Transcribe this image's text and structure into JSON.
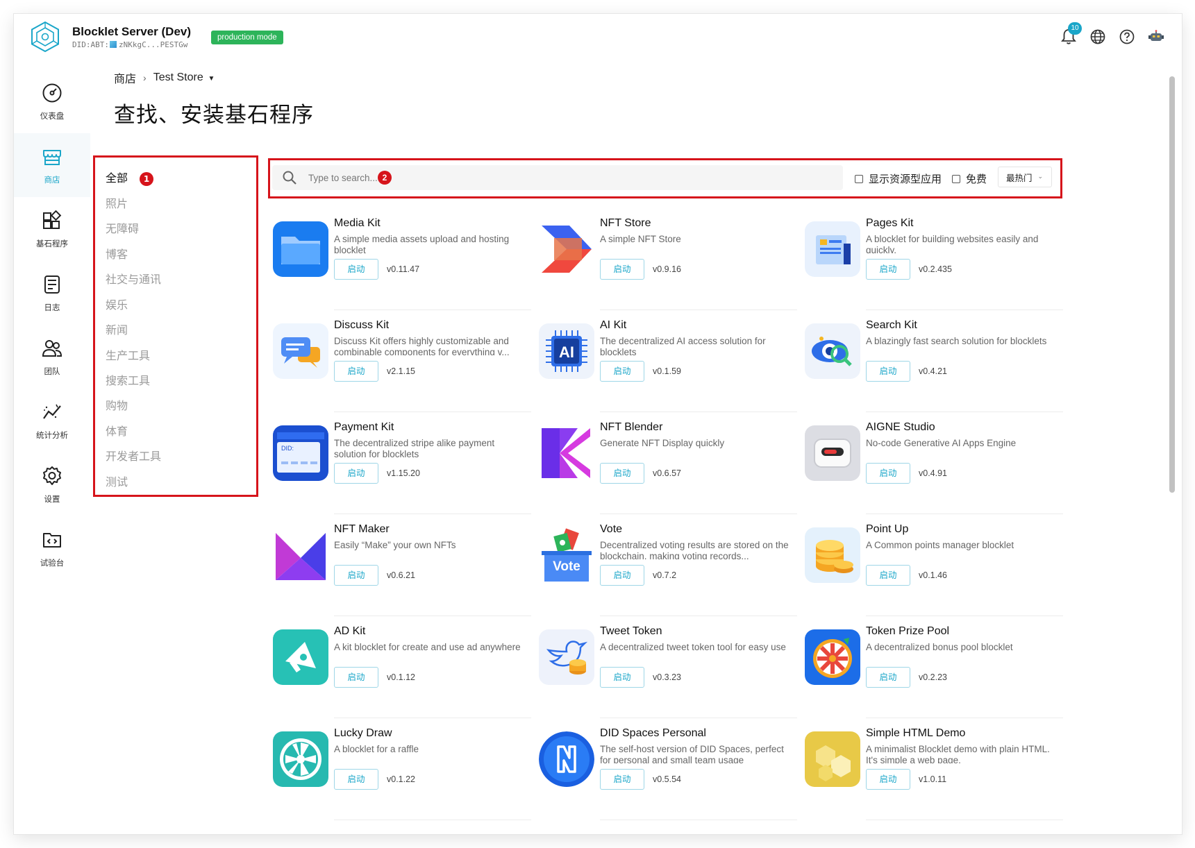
{
  "header": {
    "app_title": "Blocklet Server (Dev)",
    "did_prefix": "DID:ABT:",
    "did_value": "zNKkgC...PESTGw",
    "mode_badge": "production mode",
    "notification_count": "10"
  },
  "colors": {
    "accent": "#1aa6c9",
    "badge_green": "#2db45a",
    "highlight_red": "#d6141b"
  },
  "sidenav": [
    {
      "label": "仪表盘",
      "icon": "dashboard-icon"
    },
    {
      "label": "商店",
      "icon": "store-icon",
      "active": true
    },
    {
      "label": "基石程序",
      "icon": "blocklets-icon"
    },
    {
      "label": "日志",
      "icon": "logs-icon"
    },
    {
      "label": "团队",
      "icon": "team-icon"
    },
    {
      "label": "统计分析",
      "icon": "analytics-icon"
    },
    {
      "label": "设置",
      "icon": "settings-icon"
    },
    {
      "label": "试验台",
      "icon": "playground-icon"
    }
  ],
  "breadcrumb": {
    "root": "商店",
    "separator": "›",
    "current": "Test Store"
  },
  "page_title": "查找、安装基石程序",
  "categories": {
    "marker": "1",
    "items": [
      "全部",
      "照片",
      "无障碍",
      "博客",
      "社交与通讯",
      "娱乐",
      "新闻",
      "生产工具",
      "搜索工具",
      "购物",
      "体育",
      "开发者工具",
      "测试"
    ]
  },
  "search": {
    "placeholder": "Type to search...",
    "marker": "2",
    "show_resource_label": "显示资源型应用",
    "free_label": "免费",
    "sort_value": "最热门"
  },
  "apps": [
    {
      "name": "Media Kit",
      "desc": "A simple media assets upload and hosting blocklet",
      "version": "v0.11.47",
      "button": "启动",
      "icon": "folder-icon"
    },
    {
      "name": "NFT Store",
      "desc": "A simple NFT Store",
      "version": "v0.9.16",
      "button": "启动",
      "icon": "nft-store-icon"
    },
    {
      "name": "Pages Kit",
      "desc": "A blocklet for building websites easily and quickly.",
      "version": "v0.2.435",
      "button": "启动",
      "icon": "pages-icon"
    },
    {
      "name": "Discuss Kit",
      "desc": "Discuss Kit offers highly customizable and combinable components for everything v...",
      "version": "v2.1.15",
      "button": "启动",
      "icon": "chat-icon"
    },
    {
      "name": "AI Kit",
      "desc": "The decentralized AI access solution for blocklets",
      "version": "v0.1.59",
      "button": "启动",
      "icon": "ai-chip-icon"
    },
    {
      "name": "Search Kit",
      "desc": "A blazingly fast search solution for blocklets",
      "version": "v0.4.21",
      "button": "启动",
      "icon": "search-eye-icon"
    },
    {
      "name": "Payment Kit",
      "desc": "The decentralized stripe alike payment solution for blocklets",
      "version": "v1.15.20",
      "button": "启动",
      "icon": "payment-card-icon"
    },
    {
      "name": "NFT Blender",
      "desc": "Generate NFT Display quickly",
      "version": "v0.6.57",
      "button": "启动",
      "icon": "blender-icon"
    },
    {
      "name": "AIGNE Studio",
      "desc": "No-code Generative AI Apps Engine",
      "version": "v0.4.91",
      "button": "启动",
      "icon": "robot-icon"
    },
    {
      "name": "NFT Maker",
      "desc": "Easily “Make” your own NFTs",
      "version": "v0.6.21",
      "button": "启动",
      "icon": "nft-maker-icon"
    },
    {
      "name": "Vote",
      "desc": "Decentralized voting results are stored on the blockchain, making voting records...",
      "version": "v0.7.2",
      "button": "启动",
      "icon": "vote-box-icon",
      "icon_text": "Vote"
    },
    {
      "name": "Point Up",
      "desc": "A Common points manager blocklet",
      "version": "v0.1.46",
      "button": "启动",
      "icon": "coins-stack-icon"
    },
    {
      "name": "AD Kit",
      "desc": "A kit blocklet for create and use ad anywhere",
      "version": "v0.1.12",
      "button": "启动",
      "icon": "megaphone-icon"
    },
    {
      "name": "Tweet Token",
      "desc": "A decentralized tweet token tool for easy use",
      "version": "v0.3.23",
      "button": "启动",
      "icon": "bird-coins-icon"
    },
    {
      "name": "Token Prize Pool",
      "desc": "A decentralized bonus pool blocklet",
      "version": "v0.2.23",
      "button": "启动",
      "icon": "prize-wheel-icon"
    },
    {
      "name": "Lucky Draw",
      "desc": "A blocklet for a raffle",
      "version": "v0.1.22",
      "button": "启动",
      "icon": "raffle-wheel-icon"
    },
    {
      "name": "DID Spaces Personal",
      "desc": "The self-host version of DID Spaces, perfect for personal and small team usage",
      "version": "v0.5.54",
      "button": "启动",
      "icon": "did-spaces-icon"
    },
    {
      "name": "Simple HTML Demo",
      "desc": "A minimalist Blocklet demo with plain HTML. It's simple a web page.",
      "version": "v1.0.11",
      "button": "启动",
      "icon": "hexagons-icon"
    }
  ]
}
